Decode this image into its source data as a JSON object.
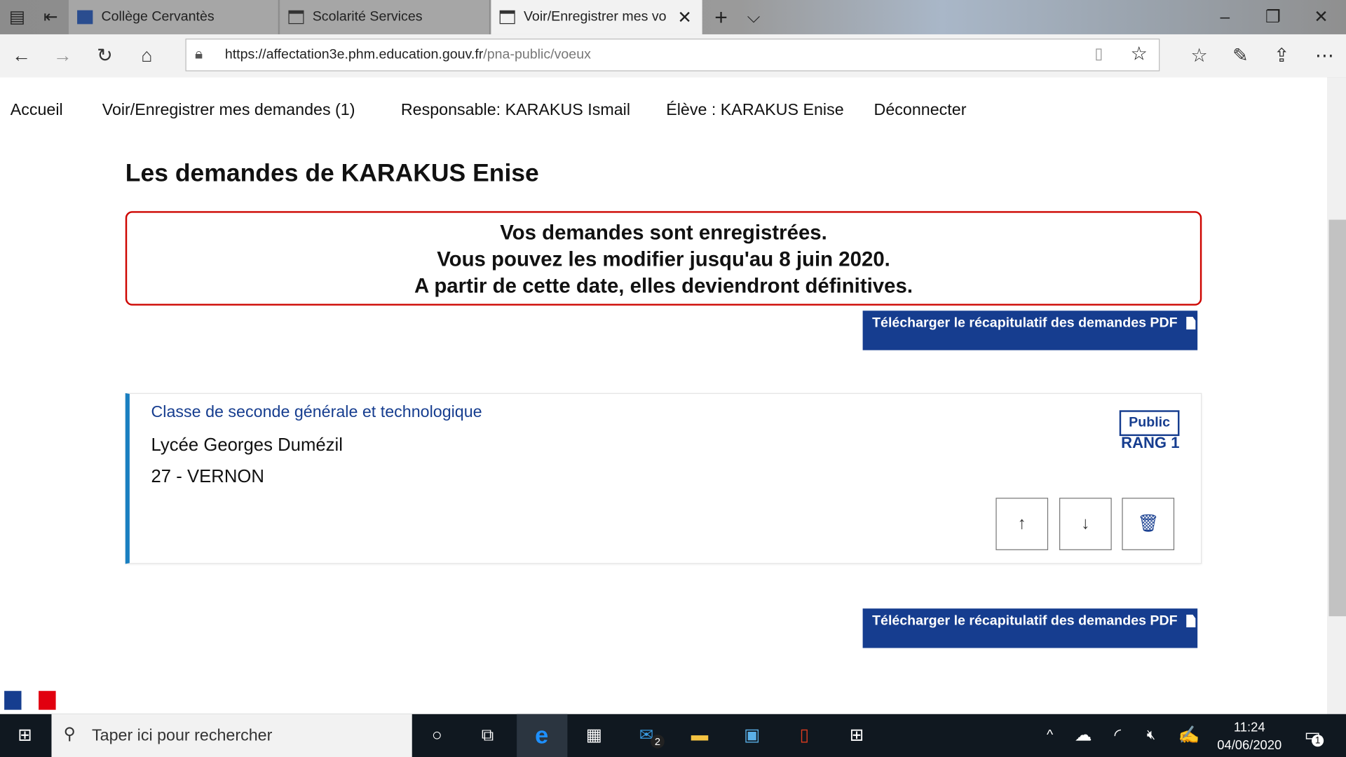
{
  "browser": {
    "tabs": [
      {
        "label": "Collège Cervantès",
        "active": false
      },
      {
        "label": "Scolarité Services",
        "active": false
      },
      {
        "label": "Voir/Enregistrer mes vo",
        "active": true
      }
    ],
    "url_host": "https://affectation3e.phm.education.gouv.fr",
    "url_path": "/pna-public/voeux"
  },
  "menu": [
    "Accueil",
    "Voir/Enregistrer mes demandes (1)",
    "Responsable: KARAKUS Ismail",
    "Élève : KARAKUS Enise",
    "Déconnecter"
  ],
  "page": {
    "title": "Les demandes de KARAKUS Enise",
    "alert": [
      "Vos demandes sont enregistrées.",
      "Vous pouvez les modifier jusqu'au 8 juin 2020.",
      "A partir de cette date, elles deviendront définitives."
    ],
    "download_label": "Télécharger le récapitulatif des demandes PDF",
    "request": {
      "category": "Classe de seconde générale et technologique",
      "school": "Lycée Georges Dumézil",
      "city": "27 - VERNON",
      "badge": "Public",
      "rank": "RANG 1"
    }
  },
  "taskbar": {
    "search_placeholder": "Taper ici pour rechercher",
    "mail_badge": "2",
    "time": "11:24",
    "date": "04/06/2020",
    "notif_count": "1"
  },
  "colors": {
    "primary": "#163d8f",
    "alert_border": "#ce0500",
    "card_accent": "#1a7fc0"
  }
}
